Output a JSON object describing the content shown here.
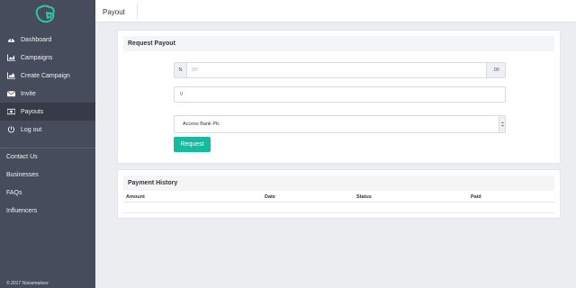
{
  "sidebar": {
    "logo_icon": "brand-logo-icon",
    "items": [
      {
        "label": "Dashboard",
        "icon": "dashboard-icon",
        "active": false
      },
      {
        "label": "Campaigns",
        "icon": "line-chart-icon",
        "active": false
      },
      {
        "label": "Create Campaign",
        "icon": "area-chart-icon",
        "active": false
      },
      {
        "label": "Invite",
        "icon": "envelope-icon",
        "active": false
      },
      {
        "label": "Payouts",
        "icon": "money-icon",
        "active": true
      },
      {
        "label": "Log out",
        "icon": "logout-icon",
        "active": false
      }
    ],
    "links": [
      {
        "label": "Contact Us"
      },
      {
        "label": "Businesses"
      },
      {
        "label": "FAQs"
      },
      {
        "label": "Influencers"
      }
    ],
    "copyright": "© 2017 Noisemakerz"
  },
  "header": {
    "title": "Payout"
  },
  "request_payout": {
    "title": "Request Payout",
    "currency_prefix": "N",
    "amount_placeholder": "00",
    "decimal_suffix": ".00",
    "account_number_value": "0",
    "bank_selected": "Access Bank Plc",
    "request_button": "Request"
  },
  "payment_history": {
    "title": "Payment History",
    "columns": [
      "Amount",
      "Date",
      "Status",
      "Paid"
    ],
    "rows": []
  },
  "colors": {
    "sidebar_bg": "#464c5b",
    "active_item_bg": "#363b47",
    "accent": "#17b99f",
    "page_bg": "#ebedf0"
  }
}
